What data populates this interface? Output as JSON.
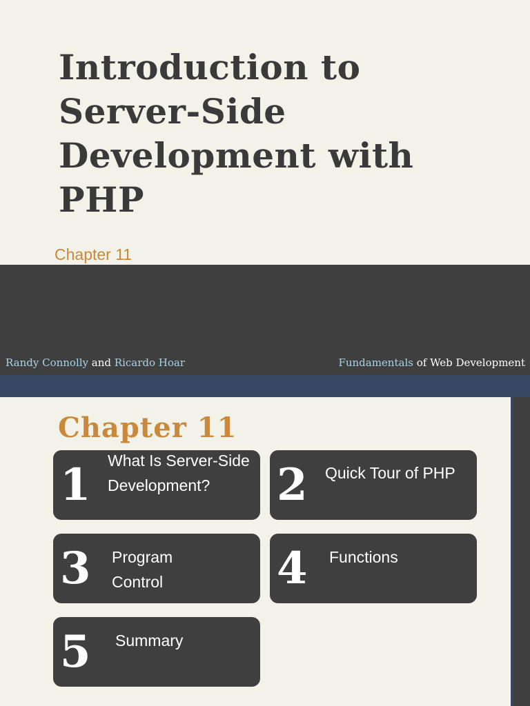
{
  "title_slide": {
    "title": "Introduction to Server-Side Development with PHP",
    "subtitle": "Chapter 11",
    "author1": "Randy Connolly",
    "author_join": "and",
    "author2": "Ricardo Hoar",
    "book_highlight": "Fundamentals",
    "book_rest": "of Web Development"
  },
  "toc_slide": {
    "heading": "Chapter 11",
    "items": [
      {
        "number": "1",
        "label": "What Is Server-Side Development?"
      },
      {
        "number": "2",
        "label": "Quick Tour of PHP"
      },
      {
        "number": "3",
        "label": "Program Control"
      },
      {
        "number": "4",
        "label": "Functions"
      },
      {
        "number": "5",
        "label": "Summary"
      }
    ]
  },
  "colors": {
    "background": "#f3f2e9",
    "dark": "#3f3f3f",
    "navy": "#374662",
    "accent_orange": "#c9883c",
    "accent_blue": "#a6d4e4"
  }
}
